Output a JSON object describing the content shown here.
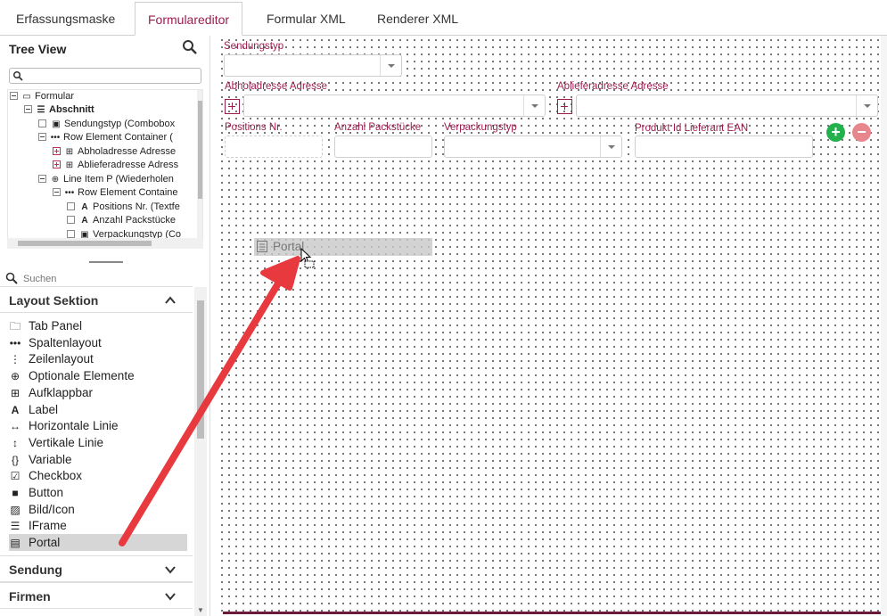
{
  "tabs": [
    "Erfassungsmaske",
    "Formulareditor",
    "Formular XML",
    "Renderer XML"
  ],
  "tree": {
    "title": "Tree View",
    "nodes": [
      "Formular",
      "Abschnitt",
      "Sendungstyp (Combobox",
      "Row Element Container (",
      "Abholadresse Adresse",
      "Ablieferadresse Adress",
      "Line Item P (Wiederholen",
      "Row Element Containe",
      "Positions Nr. (Textfe",
      "Anzahl Packstücke",
      "Verpackungstyp (Co"
    ]
  },
  "palette": {
    "search_placeholder": "Suchen",
    "section_layout": "Layout Sektion",
    "items": [
      {
        "icon": "folder-icon",
        "label": "Tab Panel"
      },
      {
        "icon": "dots-horizontal-icon",
        "label": "Spaltenlayout"
      },
      {
        "icon": "dots-vertical-icon",
        "label": "Zeilenlayout"
      },
      {
        "icon": "plus-circle-icon",
        "label": "Optionale Elemente"
      },
      {
        "icon": "plus-square-icon",
        "label": "Aufklappbar"
      },
      {
        "icon": "letter-a-icon",
        "label": "Label"
      },
      {
        "icon": "arrows-horizontal-icon",
        "label": "Horizontale Linie"
      },
      {
        "icon": "arrows-vertical-icon",
        "label": "Vertikale Linie"
      },
      {
        "icon": "braces-icon",
        "label": "Variable"
      },
      {
        "icon": "checkbox-icon",
        "label": "Checkbox"
      },
      {
        "icon": "square-filled-icon",
        "label": "Button"
      },
      {
        "icon": "image-icon",
        "label": "Bild/Icon"
      },
      {
        "icon": "iframe-icon",
        "label": "IFrame"
      },
      {
        "icon": "portal-icon",
        "label": "Portal"
      }
    ],
    "section_sendung": "Sendung",
    "section_firmen": "Firmen"
  },
  "canvas": {
    "sendungstyp_label": "Sendungstyp",
    "abholadresse_label": "Abholadresse Adresse",
    "ablieferadresse_label": "Ablieferadresse Adresse",
    "positions_label": "Positions Nr.",
    "anzahl_label": "Anzahl Packstücke",
    "verpackung_label": "Verpackungstyp",
    "produkt_label": "Produkt Id Lieferant EAN",
    "drag_label": "Portal"
  },
  "colors": {
    "accent": "#9b1d4e",
    "add_green": "#22b14c",
    "remove_red": "#e8868e",
    "arrow": "#e8393f"
  }
}
